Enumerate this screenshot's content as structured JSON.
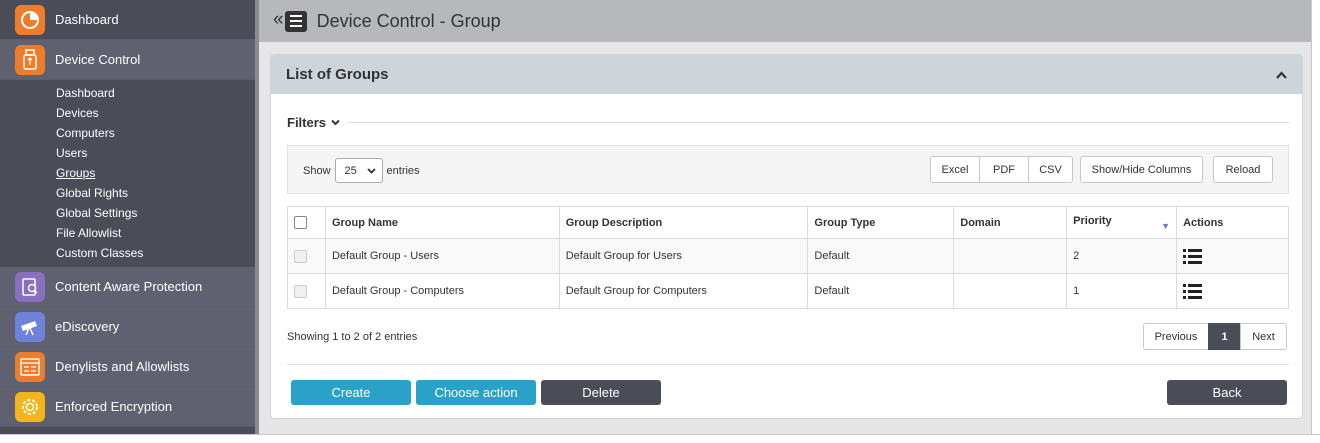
{
  "sidebar": {
    "items": [
      {
        "label": "Dashboard",
        "icon": "pie-chart-icon",
        "color": "#ee7d2b"
      },
      {
        "label": "Device Control",
        "icon": "usb-drive-icon",
        "color": "#ee7d2b"
      },
      {
        "label": "Content Aware Protection",
        "icon": "document-search-icon",
        "color": "#8a6fbf"
      },
      {
        "label": "eDiscovery",
        "icon": "telescope-icon",
        "color": "#6f82d9"
      },
      {
        "label": "Denylists and Allowlists",
        "icon": "list-window-icon",
        "color": "#ee7d2b"
      },
      {
        "label": "Enforced Encryption",
        "icon": "gear-lock-icon",
        "color": "#f2b51c"
      }
    ],
    "submenu": [
      "Dashboard",
      "Devices",
      "Computers",
      "Users",
      "Groups",
      "Global Rights",
      "Global Settings",
      "File Allowlist",
      "Custom Classes"
    ],
    "current_submenu": "Groups"
  },
  "header": {
    "collapse_glyph": "«",
    "title": "Device Control - Group"
  },
  "panel": {
    "title": "List of Groups",
    "filters_label": "Filters"
  },
  "toolbar": {
    "show_label": "Show",
    "page_size": "25",
    "entries_label": "entries",
    "export_buttons": [
      "Excel",
      "PDF",
      "CSV"
    ],
    "show_hide_label": "Show/Hide Columns",
    "reload_label": "Reload"
  },
  "table": {
    "columns": [
      "Group Name",
      "Group Description",
      "Group Type",
      "Domain",
      "Priority",
      "Actions"
    ],
    "sorted_column": "Priority",
    "rows": [
      {
        "name": "Default Group - Users",
        "description": "Default Group for Users",
        "type": "Default",
        "domain": "",
        "priority": "2"
      },
      {
        "name": "Default Group - Computers",
        "description": "Default Group for Computers",
        "type": "Default",
        "domain": "",
        "priority": "1"
      }
    ]
  },
  "footer": {
    "info": "Showing 1 to 2 of 2 entries",
    "pagination": {
      "previous": "Previous",
      "current": "1",
      "next": "Next"
    },
    "actions": {
      "create": "Create",
      "choose": "Choose action",
      "delete": "Delete",
      "back": "Back"
    }
  },
  "colors": {
    "sidebar_bg": "#4a4c58",
    "accent_blue": "#2aa2c8",
    "dark_button": "#4a4c58",
    "panel_header": "#cdd5db"
  }
}
